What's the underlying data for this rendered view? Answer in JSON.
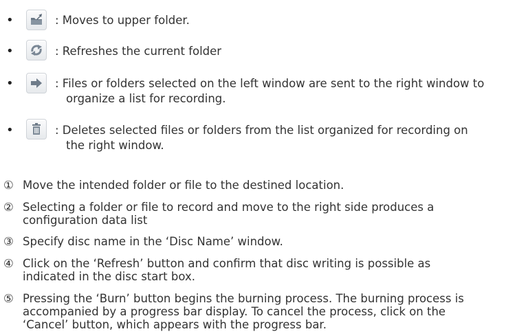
{
  "buttons": [
    {
      "icon": "upper-folder-icon",
      "text": ": Moves to upper folder."
    },
    {
      "icon": "refresh-icon",
      "text": ": Refreshes the current folder"
    },
    {
      "icon": "arrow-right-icon",
      "line1": ": Files or folders selected on the left window are sent to the right window to",
      "line2": "organize a list for recording."
    },
    {
      "icon": "trash-icon",
      "line1": ": Deletes selected files or folders from the list organized for recording on",
      "line2": "the right window."
    }
  ],
  "steps": [
    {
      "marker": "①",
      "lines": [
        "Move the intended folder or file to the destined location."
      ]
    },
    {
      "marker": "②",
      "lines": [
        "Selecting a folder or file to record and move to the right side produces a",
        "configuration data list"
      ]
    },
    {
      "marker": "③",
      "lines": [
        "Specify disc name in the ‘Disc Name’ window."
      ]
    },
    {
      "marker": "④",
      "lines": [
        "Click on the ‘Refresh’ button and confirm that disc writing is possible as",
        "indicated in the disc start box."
      ]
    },
    {
      "marker": "⑤",
      "lines": [
        "Pressing the ‘Burn’ button begins the burning process. The burning process is",
        "accompanied by a progress bar display. To cancel the process, click on the",
        "‘Cancel’ button, which appears with the progress bar."
      ]
    }
  ]
}
